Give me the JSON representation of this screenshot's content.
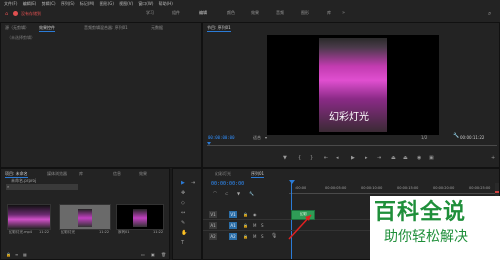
{
  "menu": {
    "items": [
      "文件(F)",
      "编辑(E)",
      "剪辑(C)",
      "序列(S)",
      "标记(M)",
      "图形(G)",
      "视图(V)",
      "窗口(W)",
      "帮助(H)"
    ]
  },
  "header": {
    "status_text": "没有存储到",
    "workspaces": [
      "学习",
      "组件",
      "编辑",
      "颜色",
      "效果",
      "音频",
      "图形",
      "库"
    ],
    "active_workspace": "编辑"
  },
  "source_panel": {
    "tabs": [
      "源（无剪辑）",
      "效果控件",
      "音频剪辑混合器: 序列01",
      "元数据"
    ],
    "active_tab": "效果控件",
    "empty_text": "（未选择剪辑）"
  },
  "program_monitor": {
    "tab": "节目: 序列01",
    "video_caption": "幻彩灯光",
    "timecode": "00:00:00:00",
    "fit_label": "适合",
    "fraction": "1/2",
    "duration": "00:00:11:22"
  },
  "project_panel": {
    "tabs": [
      "项目: 未命名",
      "媒体浏览器",
      "库",
      "信息",
      "效果"
    ],
    "active_tab": "项目: 未命名",
    "subtitle": "未命名.prproj",
    "items": [
      {
        "name": "幻彩灯光.mp4",
        "duration": "11:22"
      },
      {
        "name": "幻彩灯光",
        "duration": "11:22"
      },
      {
        "name": "序列01",
        "duration": "11:22"
      }
    ]
  },
  "timeline": {
    "tabs": [
      "幻彩灯光",
      "序列01"
    ],
    "active_tab": "序列01",
    "timecode": "00:00:00:00",
    "ruler_ticks": [
      ":00:00",
      "00:00:05:00",
      "00:00:10:00",
      "00:00:15:00",
      "00:00:20:00",
      "00:00:25:00"
    ],
    "tracks": [
      {
        "name": "V1",
        "target": "V1"
      },
      {
        "name": "A1",
        "target": "A1"
      },
      {
        "name": "A2",
        "target": "A2"
      }
    ],
    "clip_label": "幻彩"
  },
  "watermark": {
    "title": "百科全说",
    "subtitle": "助你轻松解决"
  },
  "colors": {
    "accent": "#2b7bd6",
    "timecode": "#2f8fff",
    "clip": "#2f9c56",
    "watermark": "#1f8f3a",
    "status": "#e05050"
  }
}
